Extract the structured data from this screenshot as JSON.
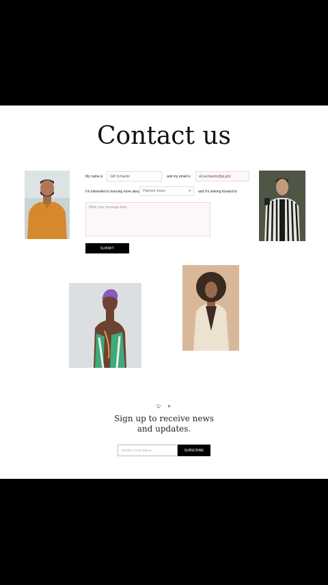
{
  "heading": "Contact us",
  "form": {
    "name_label": "My name is",
    "name_value": "Gift Schaefer",
    "email_label": "and my email is",
    "email_value": "ali.sschaefer@gi.gm|",
    "interest_label": "I'm interested in learning more about",
    "interest_selected": "Pigment Jeans",
    "looking_label": "and I'm looking forward to",
    "message_placeholder": "Write your message here",
    "submit_label": "SUBMIT"
  },
  "footer": {
    "icons": [
      "twitter-icon",
      "close-icon"
    ],
    "signup_line1": "Sign up to receive news",
    "signup_line2": "and updates.",
    "email_placeholder": "ENTER YOUR EMAIL",
    "subscribe_label": "SUBSCRIBE"
  }
}
